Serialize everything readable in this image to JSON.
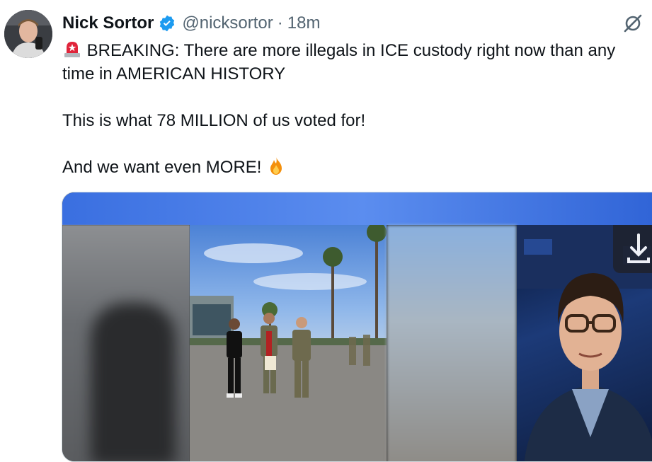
{
  "tweet": {
    "author_name": "Nick Sortor",
    "handle": "@nicksortor",
    "separator": "·",
    "time": "18m",
    "line1": "BREAKING: There are more illegals in ICE custody right now than any time in AMERICAN HISTORY",
    "line2": "This is what 78 MILLION of us voted for!",
    "line3": "And we want even MORE!"
  },
  "icons": {
    "verified": "verified-badge-icon",
    "grok": "grok-icon",
    "siren": "police-light-emoji",
    "fire": "fire-emoji",
    "download": "download-icon"
  },
  "colors": {
    "verified": "#1d9bf0",
    "text": "#0f1419",
    "secondary": "#536471"
  }
}
